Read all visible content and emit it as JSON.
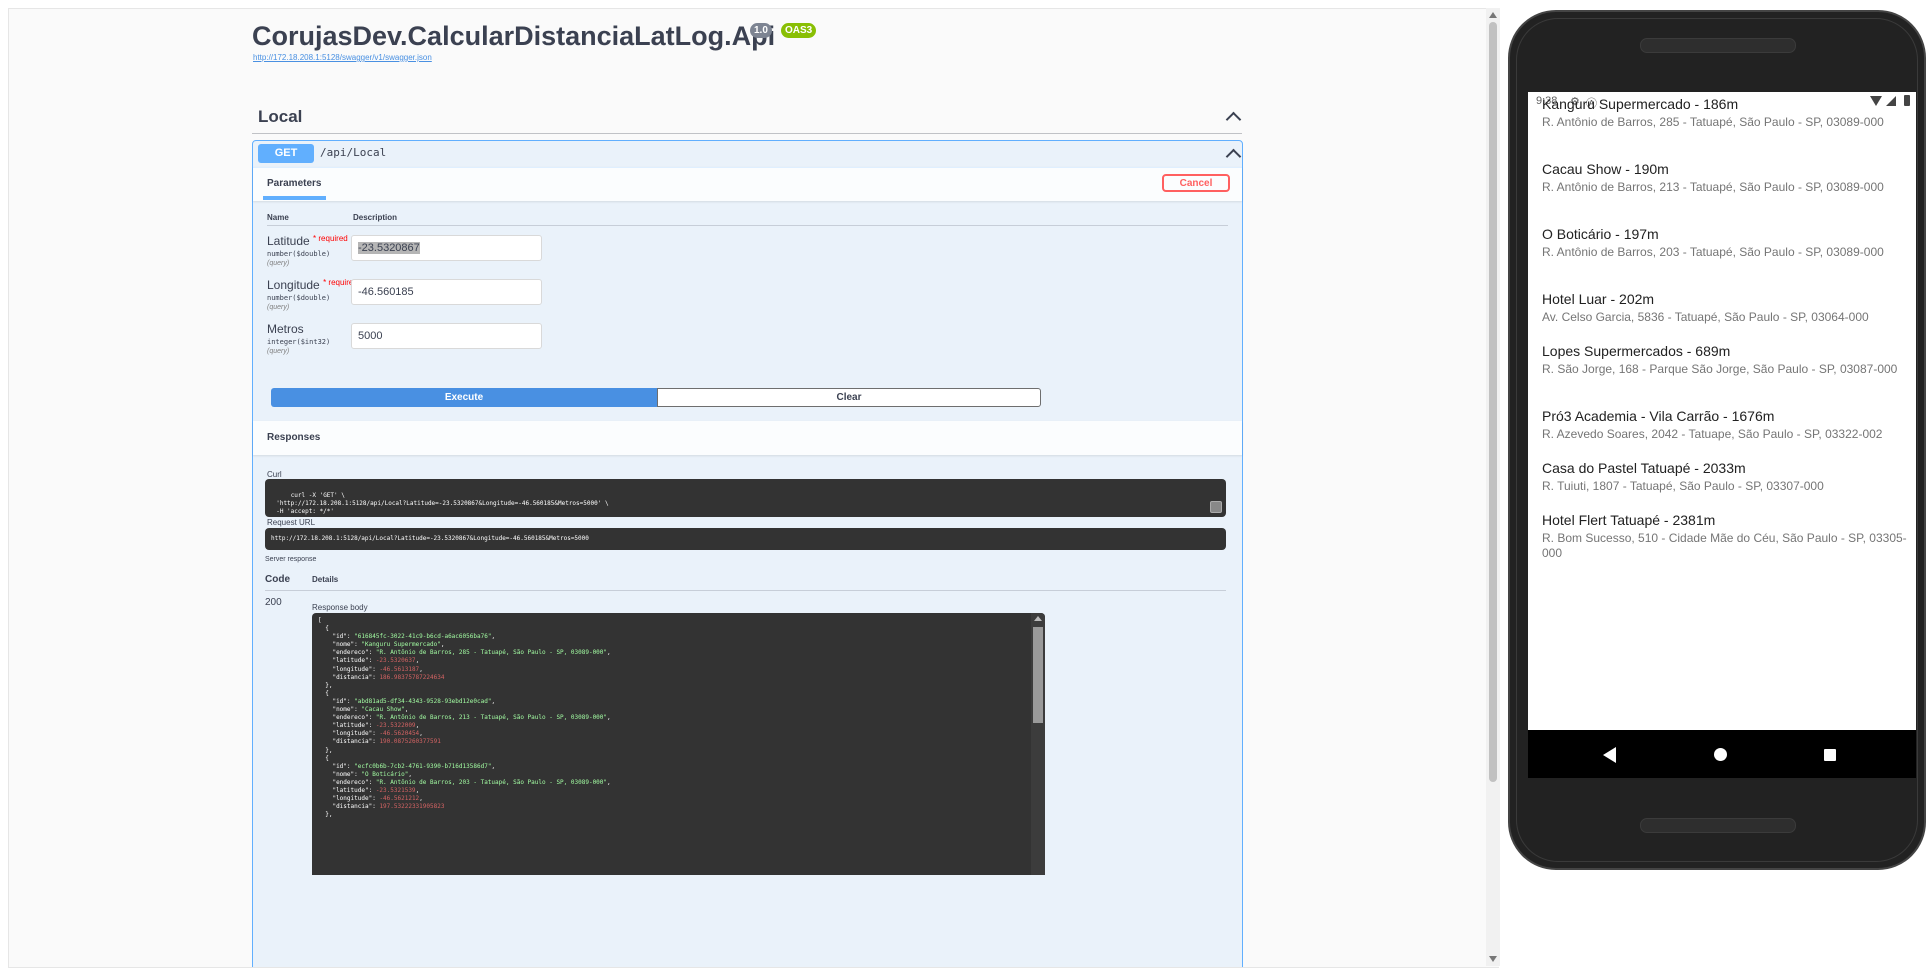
{
  "swagger": {
    "title": "CorujasDev.CalcularDistanciaLatLog.Api",
    "version_badge": "1.0",
    "oas_badge": "OAS3",
    "spec_link": "http://172.18.208.1:5128/swagger/v1/swagger.json",
    "tag": "Local",
    "operation": {
      "method": "GET",
      "path": "/api/Local",
      "parameters_tab": "Parameters",
      "cancel_label": "Cancel",
      "col_name": "Name",
      "col_description": "Description",
      "params": [
        {
          "name": "Latitude",
          "required": "* required",
          "type": "number($double)",
          "in": "(query)",
          "value": "-23.5320867"
        },
        {
          "name": "Longitude",
          "required": "* required",
          "type": "number($double)",
          "in": "(query)",
          "value": "-46.560185"
        },
        {
          "name": "Metros",
          "required": "",
          "type": "integer($int32)",
          "in": "(query)",
          "value": "5000"
        }
      ],
      "execute_label": "Execute",
      "clear_label": "Clear",
      "responses_title": "Responses",
      "curl_label": "Curl",
      "curl_text": "curl -X 'GET' \\\n  'http://172.18.208.1:5128/api/Local?Latitude=-23.5320867&Longitude=-46.560185&Metros=5000' \\\n  -H 'accept: */*'",
      "request_url_label": "Request URL",
      "request_url": "http://172.18.208.1:5128/api/Local?Latitude=-23.5320867&Longitude=-46.560185&Metros=5000",
      "server_response_label": "Server response",
      "code_header": "Code",
      "details_header": "Details",
      "status_code": "200",
      "response_body_label": "Response body",
      "response_items": [
        {
          "id": "616845fc-3022-41c9-b6cd-a6ac6056ba76",
          "nome": "Kanguru Supermercado",
          "endereco": "R. Antônio de Barros, 285 - Tatuapé, São Paulo - SP, 03089-000",
          "latitude": "-23.5320637",
          "longitude": "-46.5613187",
          "distancia": "186.98375787224634"
        },
        {
          "id": "abd81ad5-df34-4343-9528-93ebd12e0cad",
          "nome": "Cacau Show",
          "endereco": "R. Antônio de Barros, 213 - Tatuapé, São Paulo - SP, 03089-000",
          "latitude": "-23.5322009",
          "longitude": "-46.5620454",
          "distancia": "190.0875260377591"
        },
        {
          "id": "ecfc0b6b-7cb2-4761-9390-b716d13586d7",
          "nome": "O Boticário",
          "endereco": "R. Antônio de Barros, 203 - Tatuapé, São Paulo - SP, 03089-000",
          "latitude": "-23.5321539",
          "longitude": "-46.5621212",
          "distancia": "197.53222331905823"
        }
      ]
    }
  },
  "phone": {
    "status": {
      "time": "9:38"
    },
    "places": [
      {
        "title": "Kanguru Supermercado - 186m",
        "address": "R. Antônio de Barros, 285 - Tatuapé, São Paulo - SP, 03089-000"
      },
      {
        "title": "Cacau Show - 190m",
        "address": "R. Antônio de Barros, 213 - Tatuapé, São Paulo - SP, 03089-000"
      },
      {
        "title": "O Boticário - 197m",
        "address": "R. Antônio de Barros, 203 - Tatuapé, São Paulo - SP, 03089-000"
      },
      {
        "title": "Hotel Luar - 202m",
        "address": "Av. Celso Garcia, 5836 - Tatuapé, São Paulo - SP, 03064-000"
      },
      {
        "title": "Lopes Supermercados - 689m",
        "address": "R. São Jorge, 168 - Parque São Jorge, São Paulo - SP, 03087-000"
      },
      {
        "title": "Pró3 Academia - Vila Carrão - 1676m",
        "address": "R. Azevedo Soares, 2042 - Tatuape, São Paulo - SP, 03322-002"
      },
      {
        "title": "Casa do Pastel Tatuapé - 2033m",
        "address": "R. Tuiuti, 1807 - Tatuapé, São Paulo - SP, 03307-000"
      },
      {
        "title": "Hotel Flert Tatuapé - 2381m",
        "address": "R. Bom Sucesso, 510 - Cidade Mãe do Céu, São Paulo - SP, 03305-000"
      }
    ]
  },
  "colors": {
    "get_blue": "#61affe",
    "execute_blue": "#4990e2",
    "cancel_red": "#ff6060",
    "oas_green": "#89bf04"
  }
}
